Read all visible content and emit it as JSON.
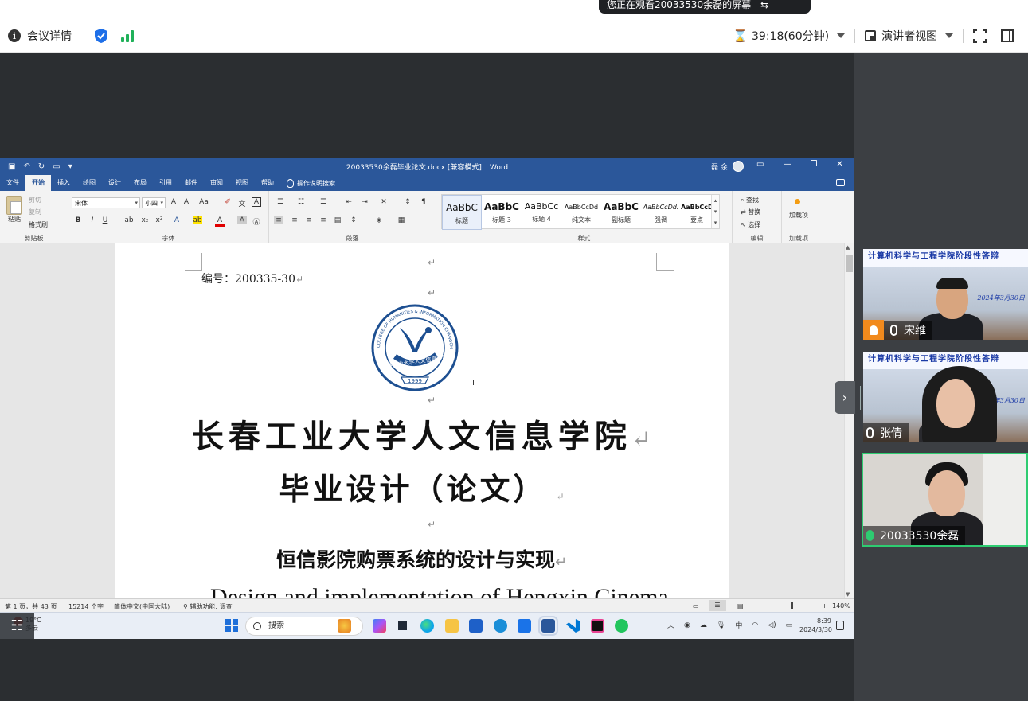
{
  "meeting": {
    "share_banner": "您正在观看20033530余磊的屏幕",
    "meeting_info_label": "会议详情",
    "timer": "39:18(60分钟)",
    "view_mode": "演讲者视图"
  },
  "word": {
    "doc_title": "20033530余磊毕业论文.docx [兼容模式]",
    "app_name": "Word",
    "user": "磊 余",
    "tabs": [
      "文件",
      "开始",
      "插入",
      "绘图",
      "设计",
      "布局",
      "引用",
      "邮件",
      "审阅",
      "视图",
      "帮助"
    ],
    "tell_me": "操作说明搜索",
    "clipboard": {
      "paste": "粘贴",
      "cut": "剪切",
      "copy": "复制",
      "format_painter": "格式刷",
      "label": "剪贴板"
    },
    "font": {
      "name": "宋体",
      "size": "小四",
      "label": "字体"
    },
    "paragraph_label": "段落",
    "styles": {
      "items": [
        {
          "sample": "AaBbC",
          "name": "标题"
        },
        {
          "sample": "AaBbC",
          "name": "标题 3"
        },
        {
          "sample": "AaBbCc",
          "name": "标题 4"
        },
        {
          "sample": "AaBbCcDd",
          "name": "纯文本"
        },
        {
          "sample": "AaBbC",
          "name": "副标题"
        },
        {
          "sample": "AaBbCcDd.",
          "name": "强调"
        },
        {
          "sample": "AaBbCcDd",
          "name": "要点"
        }
      ],
      "label": "样式"
    },
    "editing": {
      "find": "查找",
      "replace": "替换",
      "select": "选择",
      "label": "编辑"
    },
    "addins": {
      "button": "加载项",
      "label": "加载项"
    },
    "document": {
      "number_label": "编号：200335-30",
      "logo_year": "1999",
      "logo_text": "长春工业大学人文信息学院",
      "logo_ring_text": "COLLEGE OF HUMANITIES & INFORMATION CHANGCHUN UNIVERSITY OF TECHNOLOGY",
      "university": "长春工业大学人文信息学院",
      "thesis_label": "毕业设计（论文）",
      "cn_title": "恒信影院购票系统的设计与实现",
      "en_title": "Design and implementation of Hengxin Cinema"
    },
    "status": {
      "page": "第 1 页，共 43 页",
      "words": "15214 个字",
      "language": "简体中文(中国大陆)",
      "accessibility": "辅助功能: 调查",
      "zoom": "140%"
    }
  },
  "taskbar": {
    "temperature": "19°C",
    "weather": "多云",
    "search": "搜索",
    "ime": "中",
    "time": "8:39",
    "date": "2024/3/30"
  },
  "participants": [
    {
      "name": "宋维",
      "banner": "计算机科学与工程学院阶段性答辩",
      "date": "2024年3月30日",
      "host": true
    },
    {
      "name": "张倩",
      "banner": "计算机科学与工程学院阶段性答辩",
      "date": "2024年3月30日",
      "host": false
    },
    {
      "name": "20033530余磊",
      "banner": "",
      "date": "",
      "host": false,
      "speaking": true
    }
  ],
  "colors": {
    "word_blue": "#2b579a",
    "speaking_green": "#2ecc71",
    "host_orange": "#f28a1d"
  }
}
